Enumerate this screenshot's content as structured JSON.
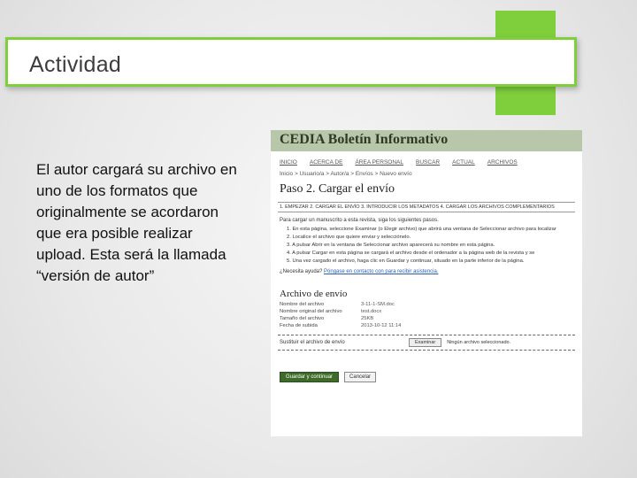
{
  "slide": {
    "title": "Actividad",
    "body": "El autor cargará su archivo en uno de los formatos que originalmente se acordaron que era posible realizar upload. Esta será la llamada “versión de autor”",
    "accent_color": "#7fcf3c"
  },
  "screenshot": {
    "site_title": "CEDIA Boletín Informativo",
    "nav": [
      "INICIO",
      "ACERCA DE",
      "ÁREA PERSONAL",
      "BUSCAR",
      "ACTUAL",
      "ARCHIVOS"
    ],
    "breadcrumb": "Inicio > Usuario/a > Autor/a > Envíos > Nuevo envío",
    "heading": "Paso 2. Cargar el envío",
    "steps": "1. EMPEZAR   2. CARGAR EL ENVÍO   3. INTRODUCIR LOS METADATOS   4. CARGAR LOS ARCHIVOS COMPLEMENTARIOS",
    "intro": "Para cargar un manuscrito a esta revista, siga los siguientes pasos.",
    "instructions": [
      "1. En esta página, seleccione Examinar (o Elegir archivo) que abrirá una ventana de Seleccionar archivo para localizar",
      "2. Localice el archivo que quiere enviar y selecciónelo.",
      "3. A pulsar Abrir en la ventana de Seleccionar archivo aparecerá su nombre en esta página.",
      "4. A pulsar Cargar en esta página se cargará el archivo desde el ordenador a la página web de la revista y se",
      "5. Una vez cargado el archivo, haga clic en Guardar y continuar, situado en la parte inferior de la página."
    ],
    "help_prefix": "¿Necesita ayuda? ",
    "help_link": "Póngase en contacto con para recibir asistencia.",
    "file_section_title": "Archivo de envío",
    "file_fields": [
      {
        "label": "Nombre del archivo",
        "value": "3-11-1-SM.doc"
      },
      {
        "label": "Nombre original del archivo",
        "value": "test.docx"
      },
      {
        "label": "Tamaño del archivo",
        "value": "25KB"
      },
      {
        "label": "Fecha de subida",
        "value": "2013-10-12 11:14"
      }
    ],
    "replace_label": "Sustituir el archivo de envío",
    "choose_file_button": "Examinar",
    "no_file_text": "Ningún archivo seleccionado.",
    "save_button": "Guardar y continuar",
    "cancel_button": "Cancelar"
  }
}
